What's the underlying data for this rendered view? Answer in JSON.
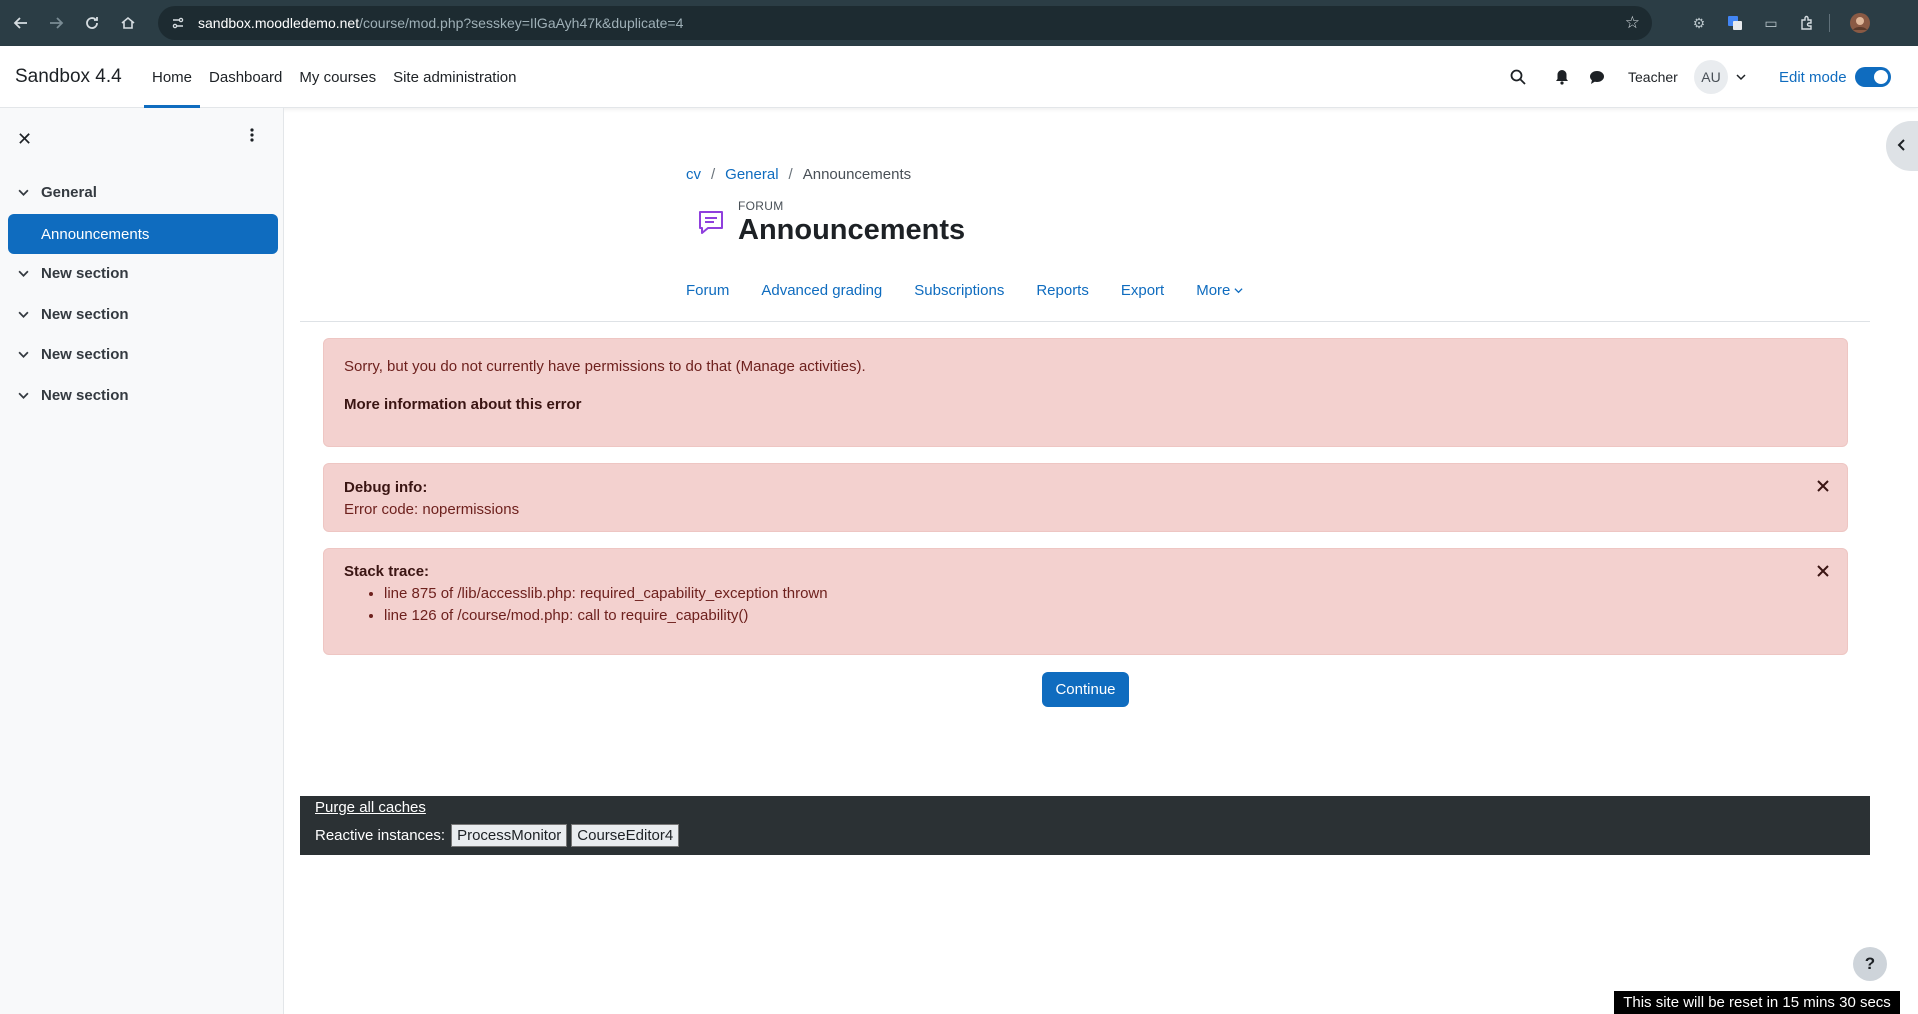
{
  "browser": {
    "url_host": "sandbox.moodledemo.net",
    "url_path": "/course/mod.php?sesskey=IlGaAyh47k&duplicate=4"
  },
  "navbar": {
    "brand": "Sandbox 4.4",
    "items": [
      {
        "label": "Home",
        "active": true
      },
      {
        "label": "Dashboard"
      },
      {
        "label": "My courses"
      },
      {
        "label": "Site administration"
      }
    ],
    "role": "Teacher",
    "avatar_initials": "AU",
    "edit_mode_label": "Edit mode"
  },
  "drawer": {
    "sections": [
      {
        "label": "General"
      },
      {
        "label": "New section"
      },
      {
        "label": "New section"
      },
      {
        "label": "New section"
      },
      {
        "label": "New section"
      }
    ],
    "active_item": "Announcements"
  },
  "breadcrumb": {
    "items": [
      "cv",
      "General",
      "Announcements"
    ]
  },
  "header": {
    "pre_title": "FORUM",
    "title": "Announcements"
  },
  "secondary_nav": {
    "items": [
      "Forum",
      "Advanced grading",
      "Subscriptions",
      "Reports",
      "Export",
      "More"
    ]
  },
  "error": {
    "message": "Sorry, but you do not currently have permissions to do that (Manage activities).",
    "more_info": "More information about this error"
  },
  "debug": {
    "heading": "Debug info:",
    "code": "Error code: nopermissions"
  },
  "stack": {
    "heading": "Stack trace:",
    "lines": [
      "line 875 of /lib/accesslib.php: required_capability_exception thrown",
      "line 126 of /course/mod.php: call to require_capability()"
    ]
  },
  "continue_label": "Continue",
  "footer": {
    "purge_label": "Purge all caches",
    "reactive_label": "Reactive instances:",
    "instances": [
      "ProcessMonitor",
      "CourseEditor4"
    ]
  },
  "help_label": "?",
  "reset_banner": "This site will be reset in 15 mins 30 secs",
  "colors": {
    "brand_blue": "#0f6cbf",
    "alert_bg": "#f3d1cf",
    "chrome_bg": "#2b3d45"
  }
}
